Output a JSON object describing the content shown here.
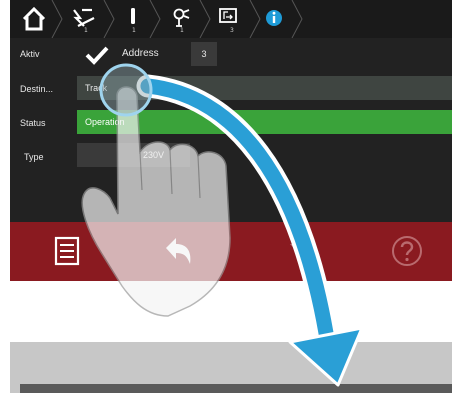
{
  "breadcrumb": {
    "items": [
      {
        "icon": "home-icon",
        "num": ""
      },
      {
        "icon": "switch-icon",
        "num": "1"
      },
      {
        "icon": "output-icon",
        "num": "1"
      },
      {
        "icon": "lamp-icon",
        "num": "1"
      },
      {
        "icon": "screen-icon",
        "num": "3"
      },
      {
        "icon": "info-icon",
        "num": ""
      }
    ]
  },
  "form": {
    "aktiv_label": "Aktiv",
    "address_label": "Address",
    "address_value": "3",
    "destination_label": "Destin...",
    "destination_value": "Track",
    "status_label": "Status",
    "status_value": "Operation",
    "type_label": "Type",
    "type_value": "230V"
  },
  "actionbar": {
    "items": [
      "menu-icon",
      "back-icon",
      "dropdown-icon",
      "help-icon"
    ]
  },
  "colors": {
    "header_bg": "#1a1a1a",
    "panel_bg": "#222222",
    "status_green": "#3aa33a",
    "action_red": "#8a1a20",
    "info_blue": "#1e9bd7",
    "arrow_blue": "#2a9fd6"
  },
  "gesture": {
    "icon": "swipe-hand-icon",
    "direction": "down"
  }
}
